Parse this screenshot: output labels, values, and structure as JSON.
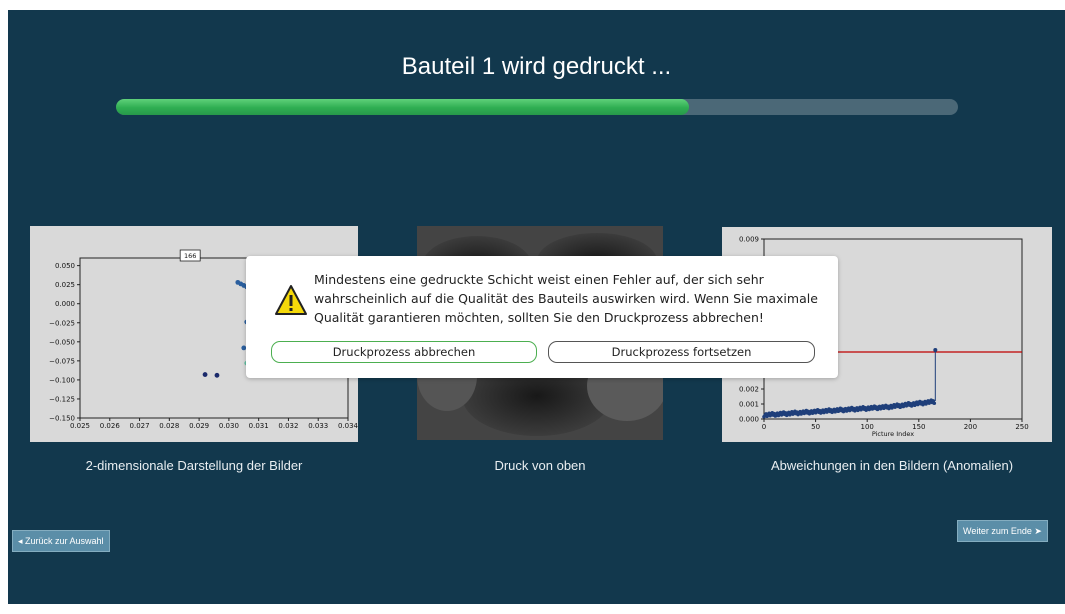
{
  "header": {
    "title": "Bauteil 1 wird gedruckt ...",
    "progress": 0.68,
    "progress_color": "#2fae52"
  },
  "panels": {
    "left_caption": "2-dimensionale Darstellung der Bilder",
    "middle_caption": "Druck von oben",
    "right_caption": "Abweichungen in den Bildern (Anomalien)"
  },
  "navigation": {
    "back_label": "◂ Zurück zur Auswahl",
    "next_label": "Weiter zum Ende ➤"
  },
  "dialog": {
    "icon": "warning-icon",
    "message": "Mindestens eine gedruckte Schicht weist einen Fehler auf, der sich sehr wahrscheinlich auf die Qualität des Bauteils auswirken wird. Wenn Sie maximale Qualität garantieren möchten, sollten Sie den Druckprozess abbrechen!",
    "abort_label": "Druckprozess abbrechen",
    "continue_label": "Druckprozess fortsetzen",
    "abort_border_color": "#4caf50"
  },
  "chart_data": [
    {
      "type": "scatter",
      "annotation": "166",
      "xlim": [
        0.025,
        0.034
      ],
      "ylim": [
        -0.15,
        0.06
      ],
      "x_ticks": [
        "0.025",
        "0.026",
        "0.027",
        "0.028",
        "0.029",
        "0.030",
        "0.031",
        "0.032",
        "0.033",
        "0.034"
      ],
      "y_ticks": [
        "0.050",
        "0.025",
        "0.000",
        "−0.025",
        "−0.050",
        "−0.075",
        "−0.100",
        "−0.125",
        "−0.150"
      ],
      "points": [
        [
          0.0292,
          -0.093
        ],
        [
          0.0296,
          -0.094
        ],
        [
          0.0305,
          -0.058
        ],
        [
          0.0306,
          -0.078
        ],
        [
          0.0306,
          -0.024
        ],
        [
          0.0307,
          -0.033
        ],
        [
          0.0307,
          -0.042
        ],
        [
          0.0308,
          -0.03
        ],
        [
          0.0309,
          -0.036
        ],
        [
          0.031,
          -0.04
        ],
        [
          0.0303,
          0.028
        ],
        [
          0.0304,
          0.026
        ],
        [
          0.0305,
          0.024
        ],
        [
          0.0306,
          0.022
        ],
        [
          0.0307,
          0.02
        ],
        [
          0.0308,
          0.018
        ],
        [
          0.0309,
          0.016
        ],
        [
          0.031,
          0.012
        ]
      ]
    },
    {
      "type": "scatter",
      "xlabel": "Picture Index",
      "xlim": [
        0,
        250
      ],
      "ylim": [
        0,
        0.009
      ],
      "x_ticks": [
        "0",
        "50",
        "100",
        "150",
        "200",
        "250"
      ],
      "y_ticks": [
        "0.009",
        "0.002",
        "0.001",
        "0.000"
      ],
      "threshold": 0.0036,
      "threshold_color": "#c00000",
      "last_point": [
        166,
        0.0038
      ]
    }
  ]
}
